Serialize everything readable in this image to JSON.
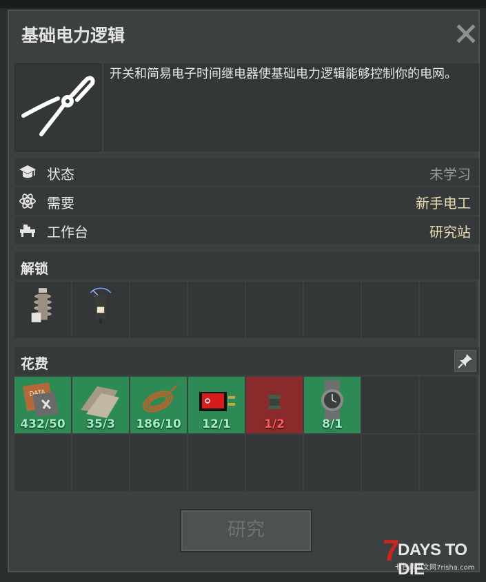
{
  "window": {
    "title": "基础电力逻辑"
  },
  "description": "开关和简易电子时间继电器使基础电力逻辑能够控制你的电网。",
  "info": [
    {
      "label": "状态",
      "value": "未学习",
      "icon": "graduation-cap-icon",
      "color": "#9a9a9a"
    },
    {
      "label": "需要",
      "value": "新手电工",
      "icon": "atom-icon",
      "color": "#e8dcb0"
    },
    {
      "label": "工作台",
      "value": "研究站",
      "icon": "workbench-icon",
      "color": "#e8dcb0"
    }
  ],
  "unlock": {
    "label": "解锁",
    "items": [
      {
        "icon": "insulator-icon"
      },
      {
        "icon": "electric-relay-icon"
      }
    ]
  },
  "cost": {
    "label": "花费",
    "pin_icon": "pin-icon",
    "items": [
      {
        "icon": "data-card-icon",
        "qty": "432/50",
        "status": "ok"
      },
      {
        "icon": "scrap-metal-icon",
        "qty": "35/3",
        "status": "ok"
      },
      {
        "icon": "wire-coil-icon",
        "qty": "186/10",
        "status": "ok"
      },
      {
        "icon": "rocker-switch-icon",
        "qty": "12/1",
        "status": "ok"
      },
      {
        "icon": "electrical-component-icon",
        "qty": "1/2",
        "status": "bad"
      },
      {
        "icon": "wristwatch-icon",
        "qty": "8/1",
        "status": "ok"
      }
    ]
  },
  "research_button": "研究",
  "watermark": {
    "brand": "7DAYS TO DIE",
    "sub": "七日杀中文网7risha.com"
  },
  "colors": {
    "ok": "#2e8a55",
    "bad": "#8a2a2a",
    "accent": "#e8dcb0"
  }
}
